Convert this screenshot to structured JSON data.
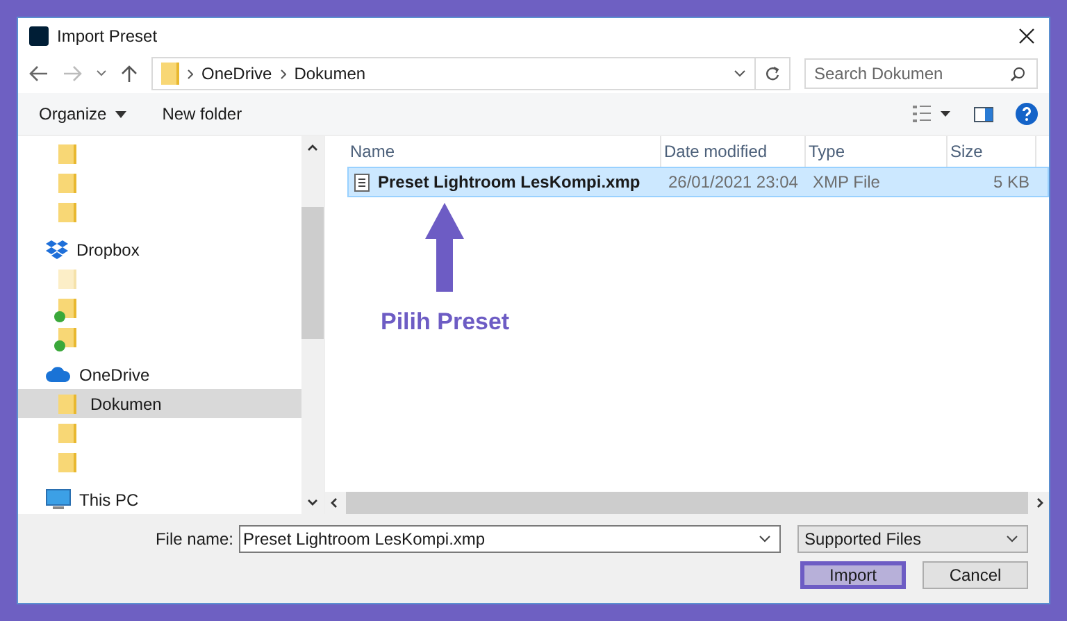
{
  "window": {
    "title": "Import Preset"
  },
  "address": {
    "path": [
      "OneDrive",
      "Dokumen"
    ],
    "search_placeholder": "Search Dokumen"
  },
  "toolbar": {
    "organize": "Organize",
    "new_folder": "New folder"
  },
  "sidebar": {
    "items": [
      {
        "kind": "folder",
        "selected": false
      },
      {
        "kind": "folder",
        "selected": false
      },
      {
        "kind": "folder",
        "selected": false
      },
      {
        "kind": "dropbox",
        "label": "Dropbox",
        "selected": false,
        "children": [
          {
            "kind": "folder",
            "selected": false,
            "dimmed": true,
            "synced": false
          },
          {
            "kind": "folder",
            "selected": false,
            "dimmed": false,
            "synced": true
          },
          {
            "kind": "folder",
            "selected": false,
            "dimmed": false,
            "synced": true
          }
        ]
      },
      {
        "kind": "onedrive",
        "label": "OneDrive",
        "selected": false,
        "children": [
          {
            "kind": "folder",
            "label": "Dokumen",
            "selected": true,
            "dimmed": false,
            "synced": false
          },
          {
            "kind": "folder",
            "selected": false,
            "dimmed": false,
            "synced": false
          },
          {
            "kind": "folder",
            "selected": false,
            "dimmed": false,
            "synced": false
          }
        ]
      },
      {
        "kind": "pc",
        "label": "This PC",
        "selected": false
      }
    ]
  },
  "table": {
    "columns": [
      "Name",
      "Date modified",
      "Type",
      "Size"
    ],
    "rows": [
      {
        "name": "Preset Lightroom LesKompi.xmp",
        "date": "26/01/2021 23:04",
        "type": "XMP File",
        "size": "5 KB",
        "selected": true
      }
    ]
  },
  "annotation": {
    "text": "Pilih Preset"
  },
  "footer": {
    "file_name_label": "File name:",
    "file_name": "Preset Lightroom LesKompi.xmp",
    "filter": "Supported Files",
    "buttons": [
      {
        "label": "Import",
        "focused": true
      },
      {
        "label": "Cancel",
        "focused": false
      }
    ]
  }
}
